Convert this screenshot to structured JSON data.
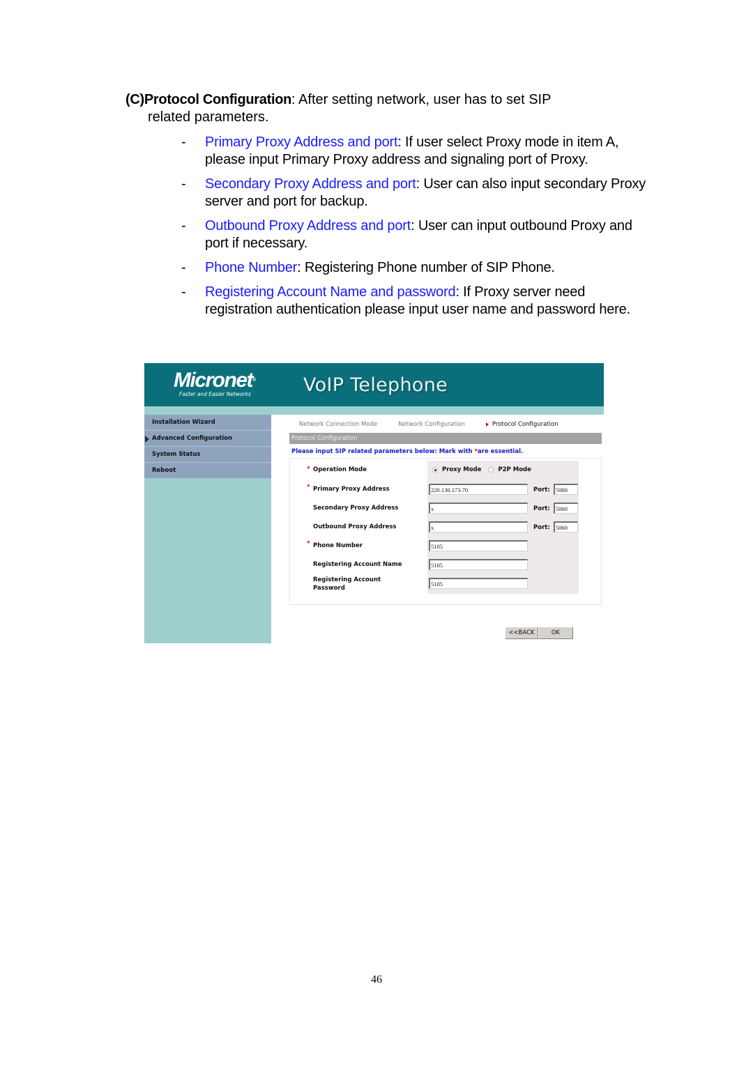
{
  "document": {
    "section_label": "(C)",
    "section_title": "Protocol Configuration",
    "section_intro_line1": ": After setting network, user has to set SIP",
    "section_intro_line2": "related parameters.",
    "bullets": [
      {
        "term": "Primary Proxy Address and port",
        "text": ": If user select Proxy mode in item A, please input Primary Proxy address and signaling port of Proxy."
      },
      {
        "term": "Secondary Proxy Address and port",
        "text": ": User can also input secondary Proxy server and port for backup."
      },
      {
        "term": "Outbound Proxy Address and port",
        "text": ": User can input outbound Proxy and port if necessary."
      },
      {
        "term": "Phone Number",
        "text": ": Registering Phone number of SIP Phone."
      },
      {
        "term": "Registering Account Name and password",
        "text": ": If Proxy server need registration authentication please input user name and password here."
      }
    ],
    "bullet_dash": "-",
    "page_number": "46"
  },
  "app": {
    "brand": "Micronet",
    "brand_mark": "®",
    "tagline": "Faster and Easier Networks",
    "title": "VoIP Telephone",
    "colors": {
      "banner": "#0a6f7b",
      "sidebar": "#9ecfcd",
      "nav_item": "#8ea4bd",
      "required": "#e01010",
      "intro": "#1a1acc"
    },
    "sidebar": {
      "items": [
        {
          "label": "Installation Wizard",
          "active": false
        },
        {
          "label": "Advanced Configuration",
          "active": true
        },
        {
          "label": "System Status",
          "active": false
        },
        {
          "label": "Reboot",
          "active": false
        }
      ]
    },
    "steps": [
      {
        "label": "Network Connection Mode",
        "active": false
      },
      {
        "label": "Network Configuration",
        "active": false
      },
      {
        "label": "Protocol Configuration",
        "active": true
      }
    ],
    "section_title": "Protocol Configuration",
    "intro_prefix": "Please input SIP related parameters below: Mark with ",
    "intro_star": "*",
    "intro_suffix": "are essential.",
    "form": {
      "required_mark": "*",
      "port_label": "Port:",
      "operation_mode": {
        "label": "Operation Mode",
        "options": [
          "Proxy Mode",
          "P2P Mode"
        ],
        "selected": "Proxy Mode"
      },
      "primary_proxy": {
        "label": "Primary Proxy Address",
        "value": "220.130.173.70",
        "port": "5060"
      },
      "secondary_proxy": {
        "label": "Secondary Proxy Address",
        "value": "x",
        "port": "5060"
      },
      "outbound_proxy": {
        "label": "Outbound Proxy Address",
        "value": "x",
        "port": "5060"
      },
      "phone_number": {
        "label": "Phone Number",
        "value": "5105"
      },
      "account_name": {
        "label": "Registering Account Name",
        "value": "5105"
      },
      "account_password": {
        "label_line1": "Registering Account",
        "label_line2": "Password",
        "value": "5105"
      }
    },
    "buttons": {
      "back": "<<BACK",
      "ok": "OK"
    }
  }
}
